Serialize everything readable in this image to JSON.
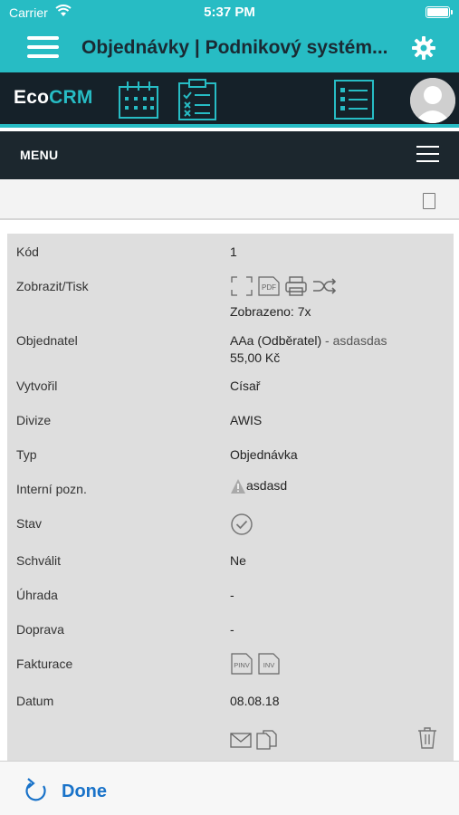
{
  "status_bar": {
    "carrier": "Carrier",
    "time": "5:37 PM"
  },
  "header": {
    "title": "Objednávky | Podnikový systém..."
  },
  "app_bar": {
    "logo_eco": "Eco",
    "logo_crm": "CRM",
    "icons": [
      "calendar-icon",
      "checklist-icon",
      "list-icon",
      "avatar"
    ]
  },
  "menu": {
    "label": "MENU"
  },
  "detail": {
    "rows": [
      {
        "label": "Kód",
        "value": "1"
      },
      {
        "label": "Zobrazit/Tisk",
        "value": "Zobrazeno: 7x"
      },
      {
        "label": "Objednatel",
        "value": "AAa (Odběratel)",
        "value_suffix": " - asdasdas",
        "value2": "55,00 Kč"
      },
      {
        "label": "Vytvořil",
        "value": "Císař"
      },
      {
        "label": "Divize",
        "value": "AWIS"
      },
      {
        "label": "Typ",
        "value": "Objednávka"
      },
      {
        "label": "Interní pozn.",
        "value": "asdasd"
      },
      {
        "label": "Stav",
        "value": ""
      },
      {
        "label": "Schválit",
        "value": "Ne"
      },
      {
        "label": "Úhrada",
        "value": "-"
      },
      {
        "label": "Doprava",
        "value": "-"
      },
      {
        "label": "Fakturace",
        "value": ""
      },
      {
        "label": "Datum",
        "value": "08.08.18"
      }
    ],
    "icon_labels": {
      "pdf": "PDF",
      "pinv": "PINV",
      "inv": "INV"
    }
  },
  "bottom_bar": {
    "done_label": "Done"
  },
  "colors": {
    "accent": "#27bcc4",
    "dark": "#152129",
    "link": "#1a73c9"
  }
}
